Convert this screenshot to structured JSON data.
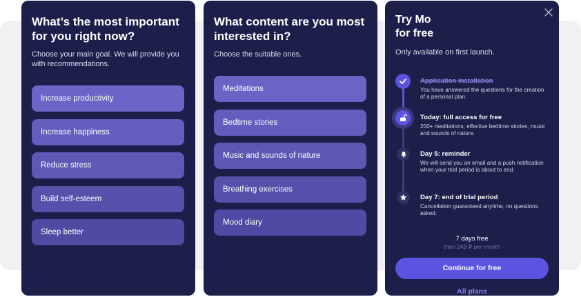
{
  "goal_screen": {
    "title": "What’s the most important for you right now?",
    "subtitle": "Choose your main goal. We will provide you with recommendations.",
    "options": [
      "Increase productivity",
      "Increase happiness",
      "Reduce stress",
      "Build self-esteem",
      "Sleep better"
    ]
  },
  "content_screen": {
    "title": "What content are you most interested in?",
    "subtitle": "Choose the suitable ones.",
    "options": [
      "Meditations",
      "Bedtime stories",
      "Music and sounds of nature",
      "Breathing exercises",
      "Mood diary"
    ]
  },
  "trial_screen": {
    "title_line1": "Try Mo",
    "title_line2": "for free",
    "subtitle": "Only available on first launch.",
    "close_icon": "close-icon",
    "steps": [
      {
        "icon": "check-icon",
        "title": "Application installation",
        "desc": "You have answered the questions for the creation of a personal plan."
      },
      {
        "icon": "unlock-icon",
        "title": "Today: full access for free",
        "desc": "200+ meditations, effective bedtime stories, music and sounds of nature."
      },
      {
        "icon": "bell-icon",
        "title": "Day 5: reminder",
        "desc": "We will send you an email and a push notification when your trial period is about to end."
      },
      {
        "icon": "star-icon",
        "title": "Day 7: end of trial period",
        "desc": "Cancellation guaranteed anytime, no questions asked."
      }
    ],
    "trial_label": "7 days free",
    "price_label": "then 249 ₽ per month",
    "cta_label": "Continue for free",
    "all_plans_label": "All plans"
  },
  "colors": {
    "card_bg": "#1c1f4a",
    "option_bg": "#5a57b2",
    "accent": "#5b54e0",
    "link": "#8a85f0"
  }
}
